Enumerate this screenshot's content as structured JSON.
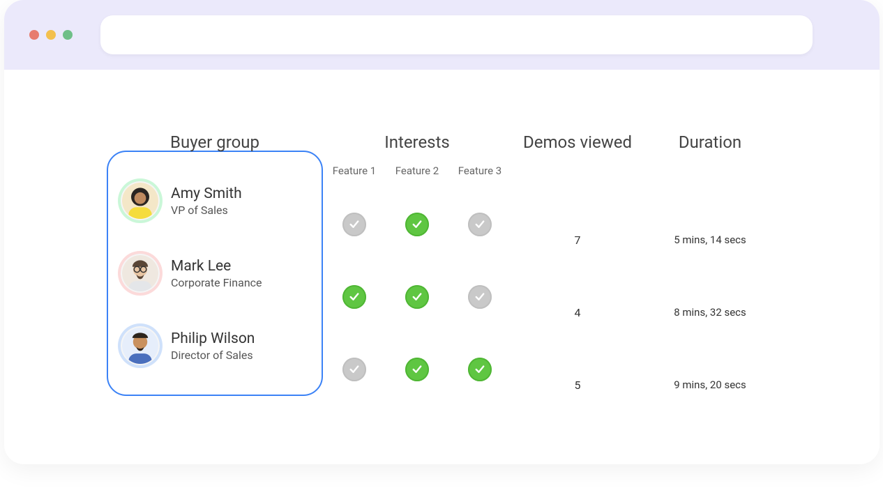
{
  "headers": {
    "buyer_group": "Buyer group",
    "interests": "Interests",
    "demos_viewed": "Demos viewed",
    "duration": "Duration"
  },
  "features": {
    "f1": "Feature 1",
    "f2": "Feature 2",
    "f3": "Feature 3"
  },
  "people": {
    "0": {
      "name": "Amy Smith",
      "title": "VP of Sales",
      "demos": "7",
      "duration": "5 mins, 14 secs"
    },
    "1": {
      "name": "Mark Lee",
      "title": "Corporate Finance",
      "demos": "4",
      "duration": "8 mins, 32 secs"
    },
    "2": {
      "name": "Philip Wilson",
      "title": "Director of Sales",
      "demos": "5",
      "duration": "9 mins, 20 secs"
    }
  },
  "interests": {
    "0": {
      "f1": false,
      "f2": true,
      "f3": false
    },
    "1": {
      "f1": true,
      "f2": true,
      "f3": false
    },
    "2": {
      "f1": false,
      "f2": true,
      "f3": true
    }
  },
  "colors": {
    "accent_blue": "#3b82f6",
    "check_green": "#5fc642",
    "check_gray": "#c9c9c9",
    "topbar_bg": "#ebe9fb"
  }
}
